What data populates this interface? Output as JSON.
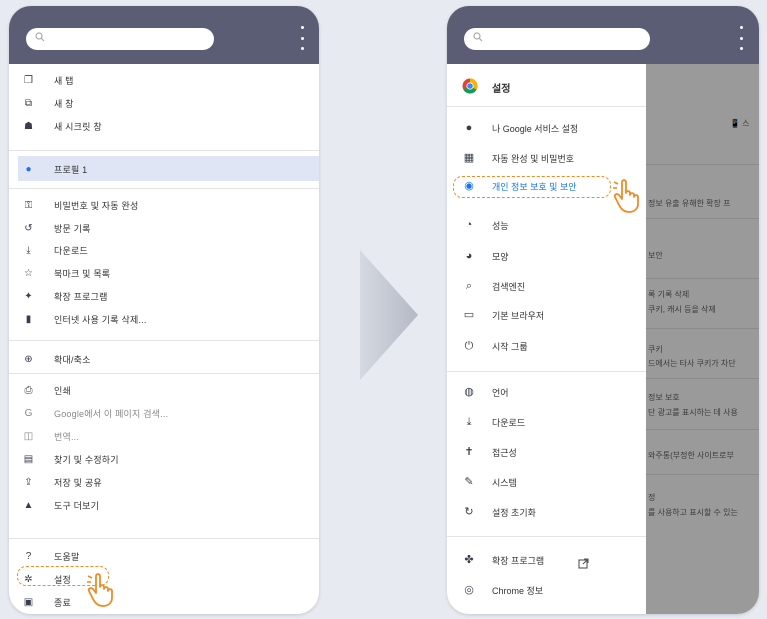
{
  "left_menu": {
    "items": [
      {
        "icon": "new-tab-icon",
        "label": "새 탭"
      },
      {
        "icon": "new-window-icon",
        "label": "새 창"
      },
      {
        "icon": "incognito-icon",
        "label": "새 시크릿 창"
      },
      {
        "icon": "profile-icon",
        "label": "프로필 1"
      },
      {
        "icon": "key-icon",
        "label": "비밀번호 및 자동 완성"
      },
      {
        "icon": "history-icon",
        "label": "방문 기록"
      },
      {
        "icon": "download-icon",
        "label": "다운로드"
      },
      {
        "icon": "star-icon",
        "label": "북마크 및 목록"
      },
      {
        "icon": "extension-icon",
        "label": "확장 프로그램"
      },
      {
        "icon": "trash-icon",
        "label": "인터넷 사용 기록 삭제..."
      },
      {
        "icon": "zoom-icon",
        "label": "확대/축소"
      },
      {
        "icon": "print-icon",
        "label": "인쇄"
      },
      {
        "icon": "google-icon",
        "label": "Google에서 이 페이지 검색..."
      },
      {
        "icon": "translate-icon",
        "label": "번역..."
      },
      {
        "icon": "find-edit-icon",
        "label": "찾기 및 수정하기"
      },
      {
        "icon": "save-share-icon",
        "label": "저장 및 공유"
      },
      {
        "icon": "tools-icon",
        "label": "도구 더보기"
      },
      {
        "icon": "help-icon",
        "label": "도움말"
      },
      {
        "icon": "settings-gear-icon",
        "label": "설정"
      },
      {
        "icon": "exit-icon",
        "label": "종료"
      }
    ]
  },
  "settings": {
    "title": "설정",
    "items": [
      {
        "icon": "person-icon",
        "label": "나 Google 서비스 설정"
      },
      {
        "icon": "clipboard-icon",
        "label": "자동 완성 및 비밀번호"
      },
      {
        "icon": "shield-icon",
        "label": "개인 정보 보호 및 보안"
      },
      {
        "icon": "speedometer-icon",
        "label": "성능"
      },
      {
        "icon": "palette-icon",
        "label": "모양"
      },
      {
        "icon": "search-icon",
        "label": "검색엔진"
      },
      {
        "icon": "browser-icon",
        "label": "기본 브라우저"
      },
      {
        "icon": "power-icon",
        "label": "시작 그룹"
      },
      {
        "icon": "globe-icon",
        "label": "언어"
      },
      {
        "icon": "download-icon",
        "label": "다운로드"
      },
      {
        "icon": "accessibility-icon",
        "label": "접근성"
      },
      {
        "icon": "wrench-icon",
        "label": "시스템"
      },
      {
        "icon": "reset-icon",
        "label": "설정 초기화"
      },
      {
        "icon": "puzzle-icon",
        "label": "확장 프로그램"
      },
      {
        "icon": "chrome-icon",
        "label": "Chrome 정보"
      }
    ]
  },
  "background_content": {
    "lines": [
      "📱 스",
      "정보 유출 유해한 확장 프",
      "보안",
      "록 기록 삭제",
      "쿠키, 캐시 등을 삭제",
      "쿠키",
      "드에서는 타사 쿠키가 차단",
      "정보 보호",
      "단 광고를 표시하는 데 사용",
      "와주통(부정한 사이트로부",
      "정",
      "를 사용하고 표시할 수 있는"
    ]
  },
  "colors": {
    "topbar": "#5b5d74",
    "accent_orange": "#f08a24",
    "highlight_row": "#dfe5f5",
    "profile_blue": "#1a73e8"
  }
}
